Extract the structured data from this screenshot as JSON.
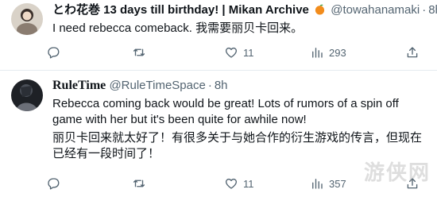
{
  "tweets": [
    {
      "display_name": "とわ花巻 13 days till birthday! | Mikan Archive",
      "handle": "@towahanamaki",
      "time": "8h",
      "text": "I need rebecca comeback. 我需要丽贝卡回来。",
      "actions": {
        "reply": "",
        "retweet": "",
        "like": "11",
        "views": "293"
      }
    },
    {
      "display_name": "RuleTime",
      "handle": "@RuleTimeSpace",
      "time": "8h",
      "text_en": "Rebecca coming back would be  great! Lots of rumors of a spin off game with her but it's been quite for awhile now!",
      "text_zh": "丽贝卡回来就太好了！有很多关于与她合作的衍生游戏的传言，但现在已经有一段时间了！",
      "actions": {
        "reply": "",
        "retweet": "",
        "like": "11",
        "views": "357"
      }
    }
  ],
  "separator": "·",
  "watermark": "游侠网",
  "icons": {
    "emoji": "tangerine-icon",
    "reply": "reply-icon",
    "retweet": "retweet-icon",
    "like": "heart-icon",
    "views": "views-icon",
    "share": "share-icon"
  }
}
